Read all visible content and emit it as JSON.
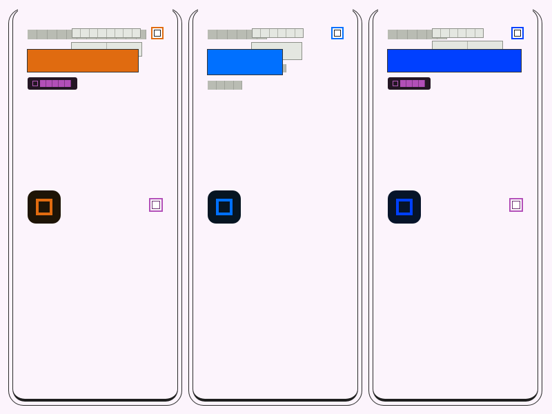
{
  "panels": [
    {
      "id": "panel-1",
      "accent": "#e06b10",
      "icon_bg": "#1e1406",
      "icon_name": "square-outline-icon",
      "has_secondary_check": true,
      "has_progress_pill": true,
      "progress_segments": 5
    },
    {
      "id": "panel-2",
      "accent": "#0070ff",
      "icon_bg": "#061522",
      "icon_name": "square-outline-icon",
      "has_secondary_check": false,
      "has_progress_pill": false,
      "progress_segments": 0
    },
    {
      "id": "panel-3",
      "accent": "#0040ff",
      "icon_bg": "#06142a",
      "icon_name": "square-outline-icon",
      "has_secondary_check": true,
      "has_progress_pill": true,
      "progress_segments": 5
    }
  ],
  "colors": {
    "background": "#fcf4fc",
    "frame": "#2a2a2a",
    "placeholder_gray": "#b9bcb3",
    "placeholder_light": "#e4e7e1",
    "pill_bg": "#241624",
    "pill_fill": "#b24fb8",
    "secondary_check": "#b24fb8"
  }
}
